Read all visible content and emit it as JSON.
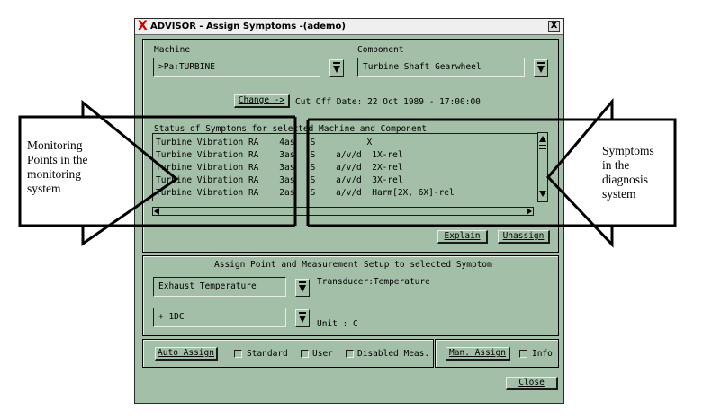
{
  "window": {
    "title": "ADVISOR - Assign Symptoms -(ademo)",
    "close_glyph": "X",
    "app_mark": "X"
  },
  "machine": {
    "label": "Machine",
    "value": ">Pa:TURBINE"
  },
  "component": {
    "label": "Component",
    "value": "Turbine Shaft Gearwheel"
  },
  "change_button": "Change ->",
  "cutoff": "Cut Off Date: 22 Oct 1989 - 17:00:00",
  "status": {
    "header": "Status of Symptoms for selected Machine and Component",
    "rows": [
      "Turbine Vibration RA    4as   S          X",
      "Turbine Vibration RA    3as   S    a/v/d  1X-rel",
      "Turbine Vibration RA    3as   S    a/v/d  2X-rel",
      "Turbine Vibration RA    3as   S    a/v/d  3X-rel",
      "Turbine Vibration RA    2as   S    a/v/d  Harm[2X, 6X]-rel"
    ]
  },
  "explain_button": "Explain",
  "unassign_button": "Unassign",
  "assign": {
    "header": "Assign Point and Measurement Setup to selected Symptom",
    "point_value": "Exhaust Temperature",
    "setup_value": "+  1DC",
    "transducer": "Transducer:Temperature",
    "unit": "Unit : C"
  },
  "options": {
    "auto_assign": "Auto Assign",
    "standard": "Standard",
    "user": "User",
    "disabled_meas": "Disabled Meas.",
    "man_assign": "Man. Assign",
    "info": "Info"
  },
  "close_button": "Close",
  "callouts": {
    "left": [
      "Monitoring",
      "Points in the",
      "monitoring",
      "system"
    ],
    "right": [
      "Symptoms",
      "in the",
      "diagnosis",
      "system"
    ]
  }
}
